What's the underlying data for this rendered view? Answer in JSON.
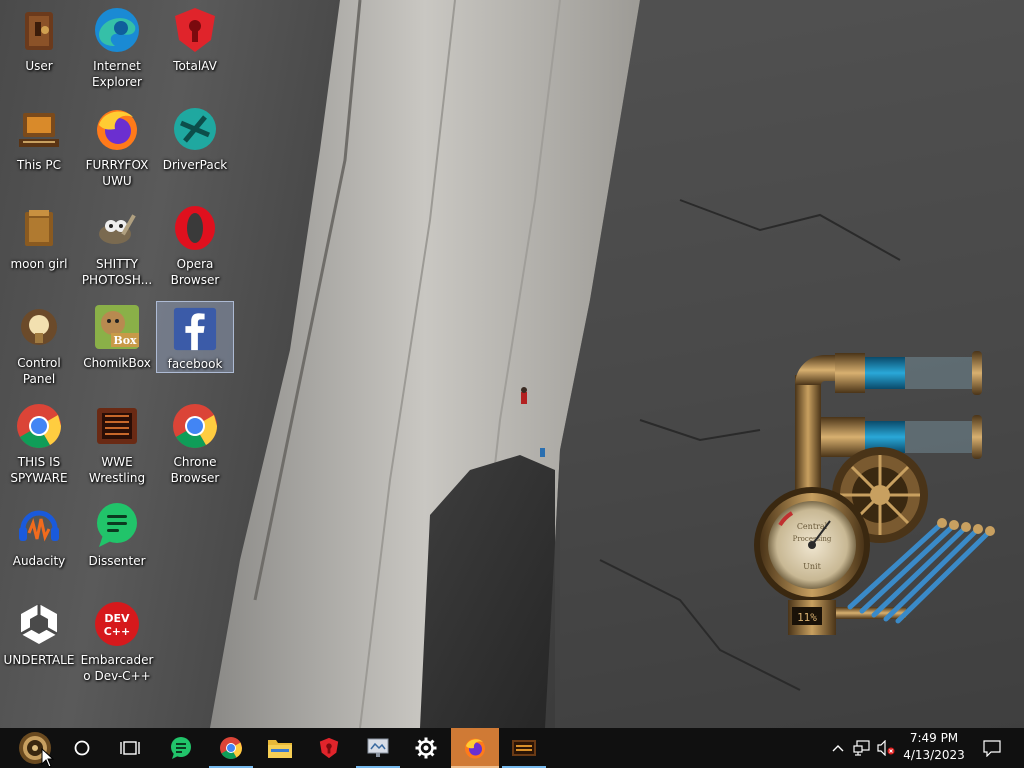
{
  "desktop": {
    "icons": [
      {
        "label": "User",
        "icon": "user-folder-icon"
      },
      {
        "label": "Internet Explorer",
        "icon": "edge-icon"
      },
      {
        "label": "TotalAV",
        "icon": "totalav-icon"
      },
      {
        "label": "This PC",
        "icon": "computer-icon"
      },
      {
        "label": "FURRYFOX UWU",
        "icon": "firefox-icon"
      },
      {
        "label": "DriverPack",
        "icon": "driverpack-icon"
      },
      {
        "label": "moon girl",
        "icon": "folder-icon"
      },
      {
        "label": "SHITTY PHOTOSH...",
        "icon": "gimp-icon"
      },
      {
        "label": "Opera Browser",
        "icon": "opera-icon"
      },
      {
        "label": "Control Panel",
        "icon": "control-panel-icon"
      },
      {
        "label": "ChomikBox",
        "icon": "chomikbox-icon",
        "badge": "Box"
      },
      {
        "label": "facebook",
        "icon": "facebook-icon",
        "selected": true
      },
      {
        "label": "THIS IS SPYWARE",
        "icon": "chrome-icon"
      },
      {
        "label": "WWE Wrestling",
        "icon": "wwe-icon"
      },
      {
        "label": "Chrone Browser",
        "icon": "chrome-icon"
      },
      {
        "label": "Audacity",
        "icon": "audacity-icon"
      },
      {
        "label": "Dissenter",
        "icon": "dissenter-icon"
      },
      {
        "label": "UNDERTALE",
        "icon": "unity-icon"
      },
      {
        "label": "Embarcadero Dev-C++",
        "icon": "devcpp-icon",
        "badge": "DEV C++"
      }
    ]
  },
  "gadget": {
    "name": "steampunk-cpu-meter",
    "dial_text": "Central Processing Unit",
    "percent_label": "11%",
    "usage_percent": 11
  },
  "taskbar": {
    "start_icon": "steampunk-start-orb-icon",
    "search_icon": "cortana-circle-icon",
    "task_view_icon": "task-view-icon",
    "apps": [
      {
        "name": "dissenter",
        "icon": "dissenter-icon",
        "running": false
      },
      {
        "name": "chrome",
        "icon": "chrome-icon",
        "running": true
      },
      {
        "name": "file-explorer",
        "icon": "folder-icon",
        "running": false
      },
      {
        "name": "totalav",
        "icon": "totalav-icon",
        "running": false
      },
      {
        "name": "presentation",
        "icon": "slides-icon",
        "running": true
      },
      {
        "name": "settings",
        "icon": "gear-icon",
        "running": false
      },
      {
        "name": "firefox",
        "icon": "firefox-icon",
        "running": true,
        "active": true
      },
      {
        "name": "wood-gadget",
        "icon": "wood-clock-icon",
        "running": true
      }
    ],
    "tray": {
      "chevron_icon": "chevron-up-icon",
      "network_icon": "network-icon",
      "volume_icon": "volume-muted-icon",
      "notification_icon": "action-center-icon",
      "time": "7:49 PM",
      "date": "4/13/2023"
    }
  },
  "colors": {
    "taskbar_bg": "#101010",
    "firefox_active": "#d07a35",
    "running_indicator": "#76b9ed",
    "selection": "#aabee6"
  }
}
